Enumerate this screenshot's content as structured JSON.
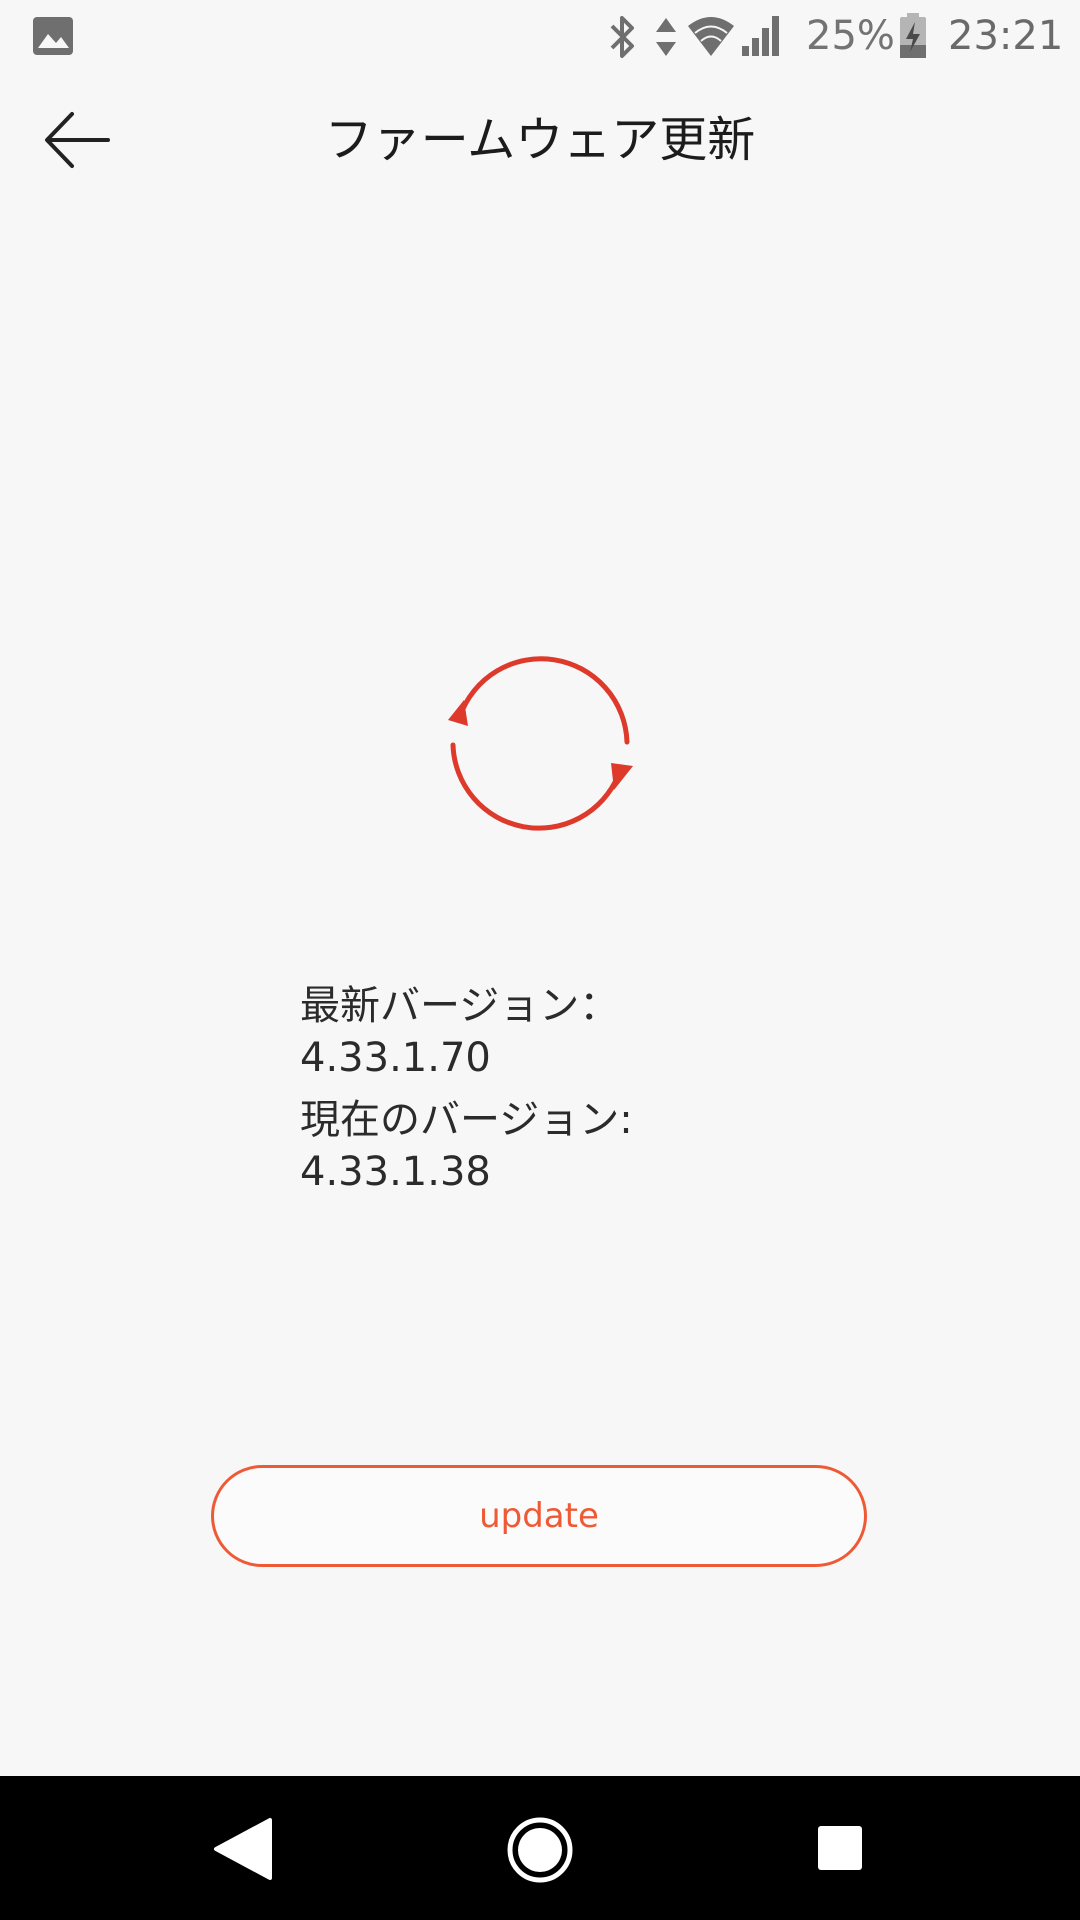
{
  "status_bar": {
    "battery_text": "25%",
    "time": "23:21",
    "icons": [
      "gallery-icon",
      "bluetooth-icon",
      "data-transfer-icon",
      "wifi-icon",
      "cell-signal-icon",
      "battery-charging-icon"
    ]
  },
  "app_bar": {
    "title": "ファームウェア更新",
    "back_icon": "arrow-left-icon"
  },
  "main": {
    "icon": "sync-icon",
    "latest_label": "最新バージョン：",
    "latest_value": "4.33.1.70",
    "current_label": "現在のバージョン:",
    "current_value": "4.33.1.38",
    "update_label": "update"
  },
  "nav_bar": {
    "icons": [
      "nav-back-icon",
      "nav-home-icon",
      "nav-recents-icon"
    ]
  },
  "colors": {
    "accent": "#ef5a36",
    "icon_red": "#de3a2c",
    "background": "#f7f7f7",
    "nav_background": "#000000"
  }
}
